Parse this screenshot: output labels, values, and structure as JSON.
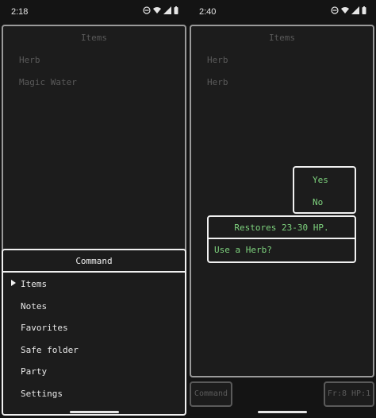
{
  "left": {
    "status": {
      "time": "2:18"
    },
    "items_panel": {
      "title": "Items",
      "items": [
        "Herb",
        "Magic Water"
      ]
    },
    "command_menu": {
      "title": "Command",
      "options": [
        "Items",
        "Notes",
        "Favorites",
        "Safe folder",
        "Party",
        "Settings"
      ],
      "selected_index": 0
    }
  },
  "right": {
    "status": {
      "time": "2:40"
    },
    "items_panel": {
      "title": "Items",
      "items": [
        "Herb",
        "Herb"
      ]
    },
    "choice": {
      "yes": "Yes",
      "no": "No"
    },
    "dialog": {
      "description": "Restores 23-30 HP.",
      "question": "Use a Herb?"
    },
    "bottom": {
      "command_label": "Command",
      "stats_label": "Fr:8 HP:1"
    }
  },
  "colors": {
    "background": "#141414",
    "panel": "#1c1c1c",
    "border_active": "#f0f0f0",
    "border_dim": "#5a5a5a",
    "text_dim": "#5a5a5a",
    "text_active": "#e8e8e8",
    "text_highlight": "#7ed37e"
  }
}
